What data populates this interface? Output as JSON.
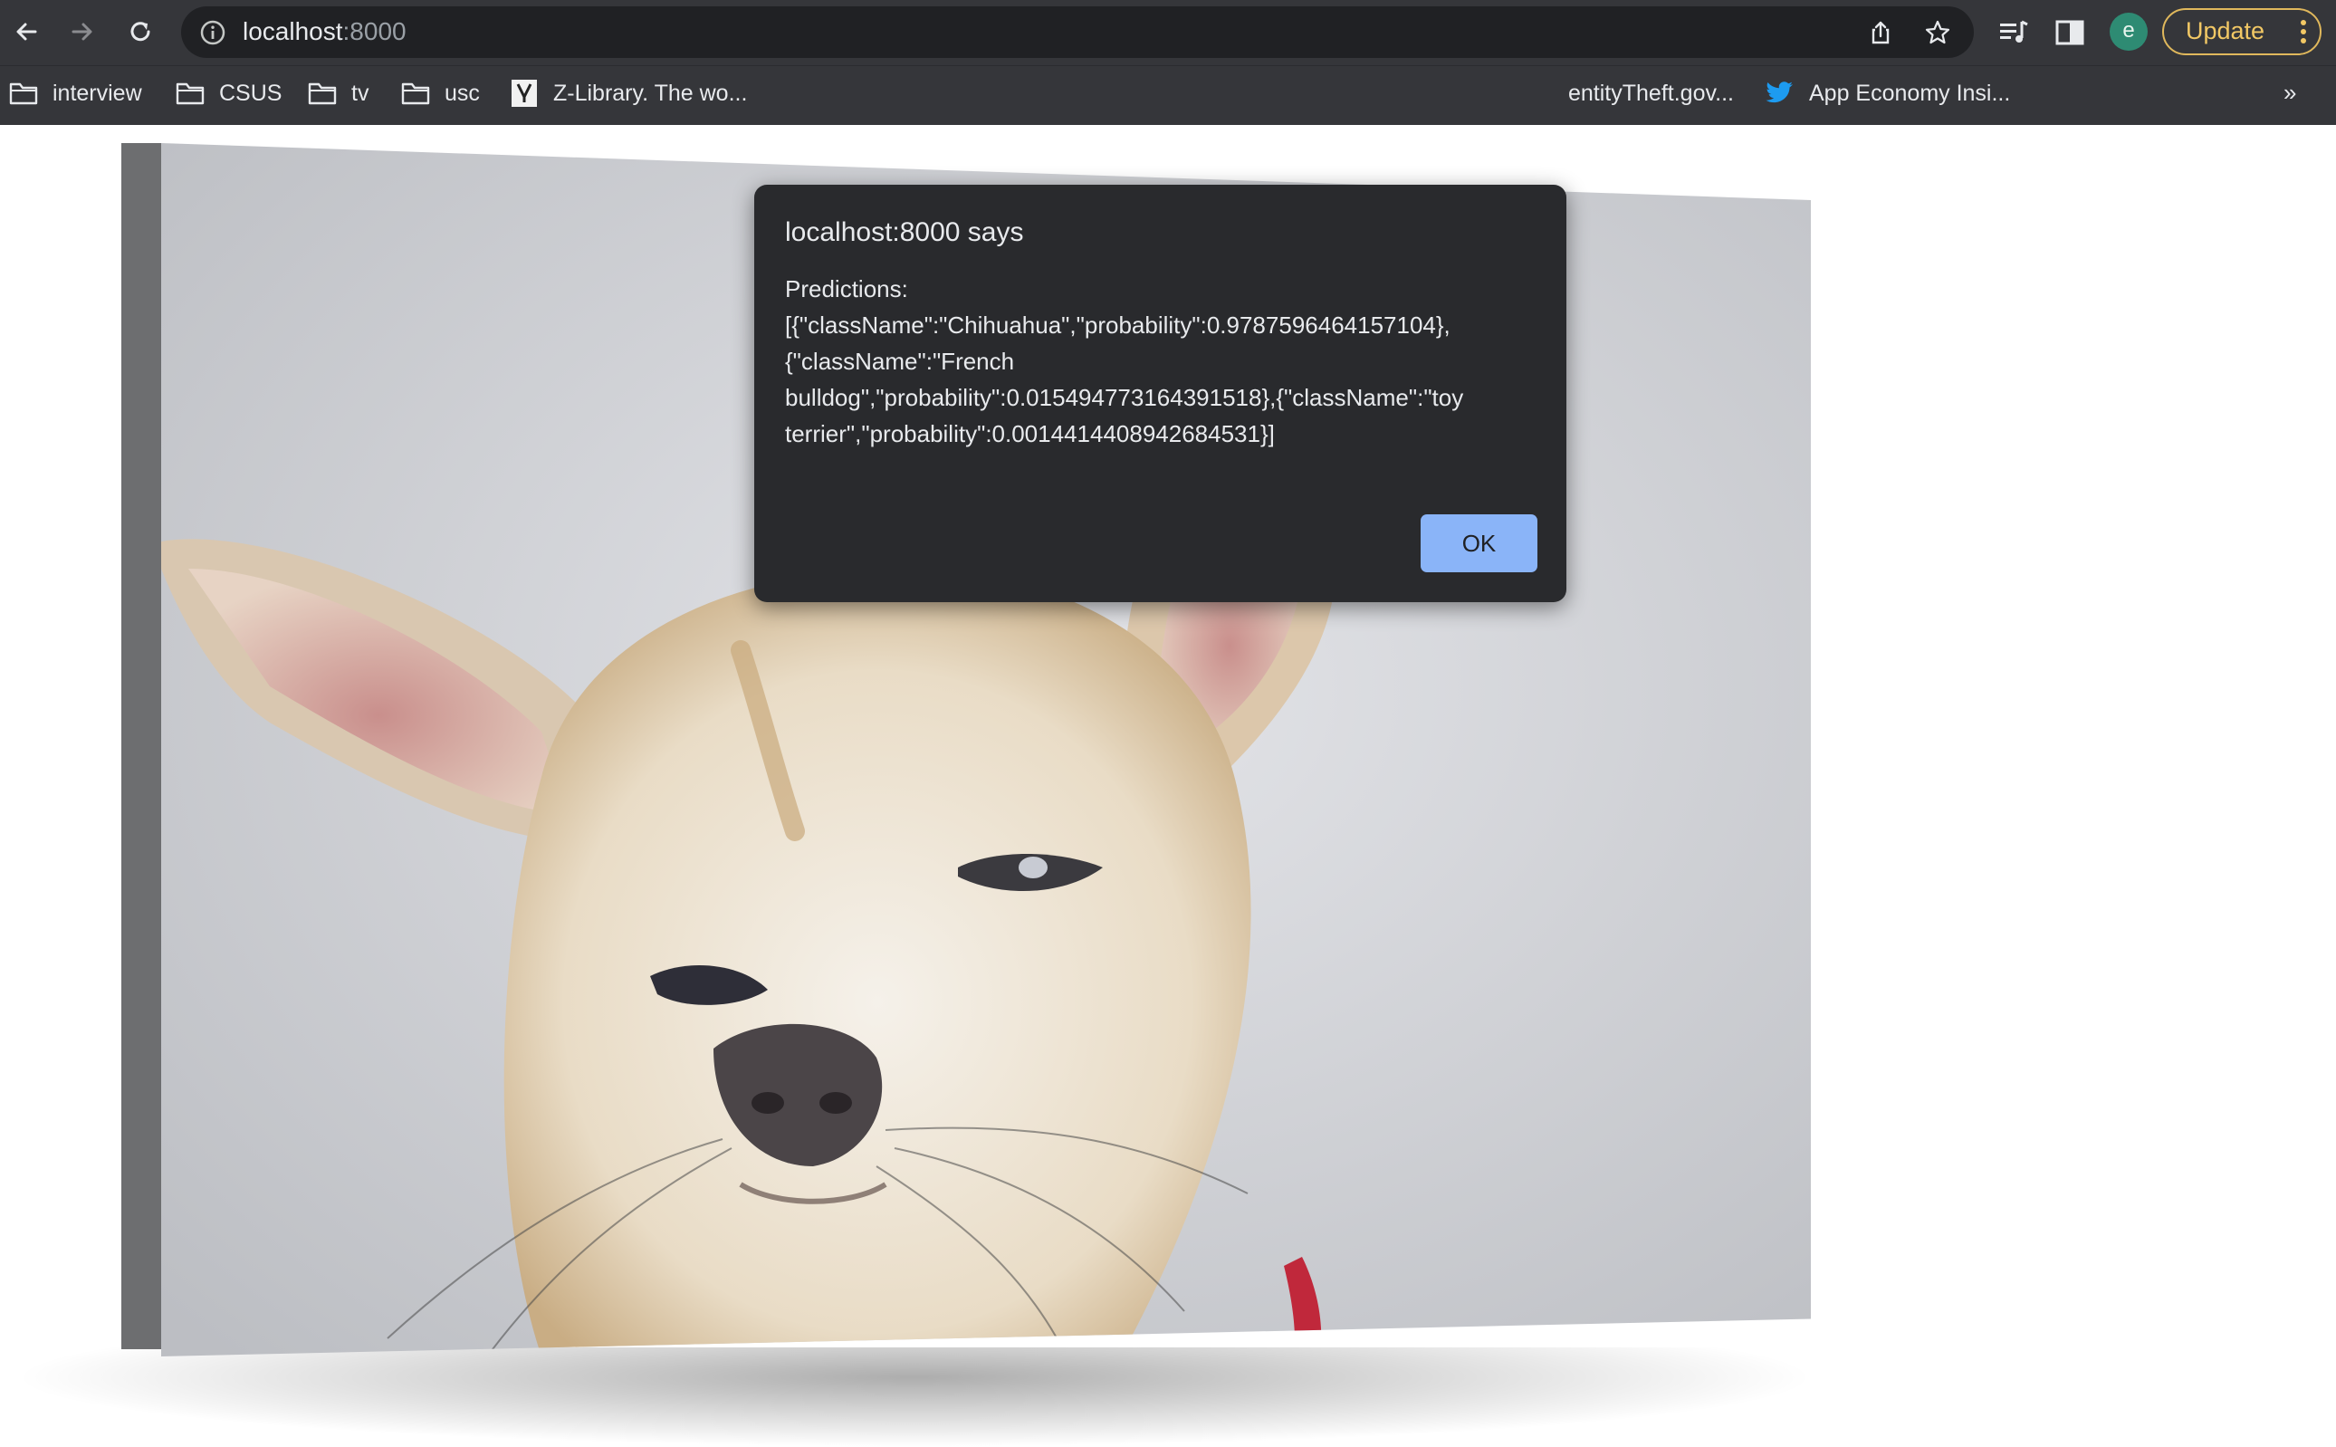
{
  "toolbar": {
    "back_icon": "back-arrow-icon",
    "forward_icon": "forward-arrow-icon",
    "reload_icon": "reload-icon",
    "url_host": "localhost",
    "url_port": ":8000",
    "update_label": "Update",
    "profile_initial": "e"
  },
  "bookmarks": [
    {
      "label": "interview",
      "icon": "folder-icon"
    },
    {
      "label": "CSUS",
      "icon": "folder-icon"
    },
    {
      "label": "tv",
      "icon": "folder-icon"
    },
    {
      "label": "usc",
      "icon": "folder-icon"
    },
    {
      "label": "Z-Library. The wo...",
      "icon": "zlibrary-icon"
    },
    {
      "label": "entityTheft.gov...",
      "icon": ""
    },
    {
      "label": "App Economy Insi...",
      "icon": "twitter-bird-icon"
    }
  ],
  "bookmarks_more": "»",
  "dialog": {
    "title": "localhost:8000 says",
    "message": "Predictions:\n[{\"className\":\"Chihuahua\",\"probability\":0.9787596464157104},\n{\"className\":\"French\nbulldog\",\"probability\":0.015494773164391518},{\"className\":\"toy\nterrier\",\"probability\":0.0014414408942684531}]",
    "ok_label": "OK"
  },
  "colors": {
    "chrome_toolbar": "#35363a",
    "omnibox": "#202124",
    "dialog_bg": "#292a2d",
    "ok_button": "#8ab4f8",
    "update_accent": "#f2c865"
  }
}
